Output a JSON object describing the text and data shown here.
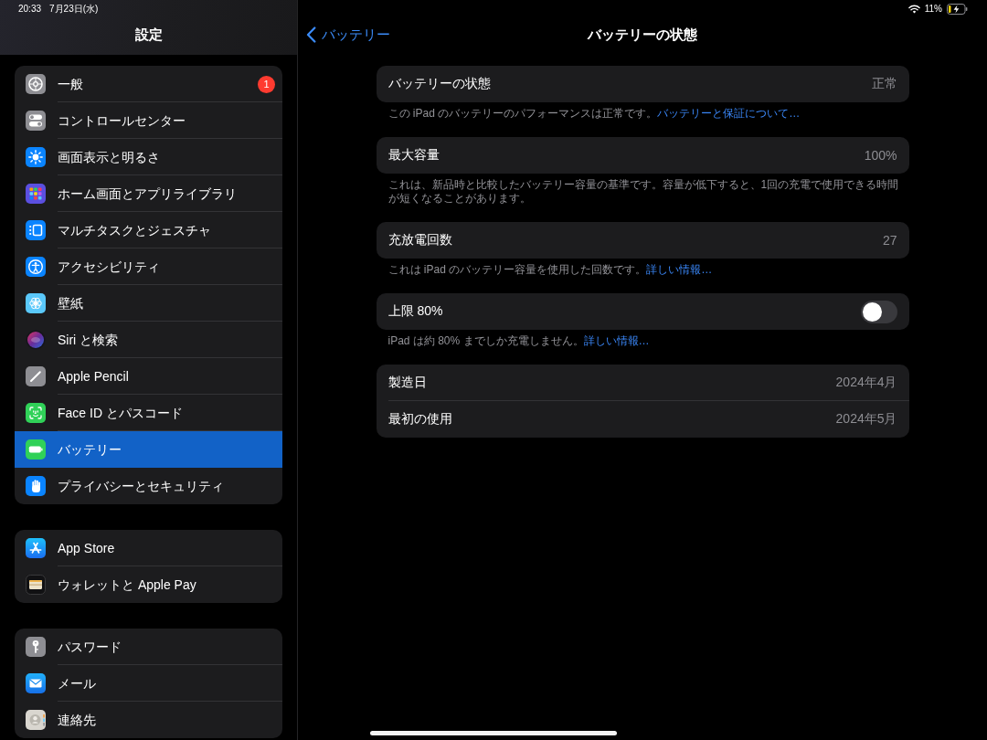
{
  "status_bar": {
    "time": "20:33",
    "date": "7月23日(水)",
    "battery": "11%"
  },
  "sidebar": {
    "title": "設定",
    "groups": [
      {
        "items": [
          {
            "label": "一般",
            "badge": "1",
            "selected": false
          },
          {
            "label": "コントロールセンター",
            "selected": false
          },
          {
            "label": "画面表示と明るさ",
            "selected": false
          },
          {
            "label": "ホーム画面とアプリライブラリ",
            "selected": false
          },
          {
            "label": "マルチタスクとジェスチャ",
            "selected": false
          },
          {
            "label": "アクセシビリティ",
            "selected": false
          },
          {
            "label": "壁紙",
            "selected": false
          },
          {
            "label": "Siri と検索",
            "selected": false
          },
          {
            "label": "Apple Pencil",
            "selected": false
          },
          {
            "label": "Face ID とパスコード",
            "selected": false
          },
          {
            "label": "バッテリー",
            "selected": true
          },
          {
            "label": "プライバシーとセキュリティ",
            "selected": false
          }
        ]
      },
      {
        "items": [
          {
            "label": "App Store",
            "selected": false
          },
          {
            "label": "ウォレットと Apple Pay",
            "selected": false
          }
        ]
      },
      {
        "items": [
          {
            "label": "パスワード",
            "selected": false
          },
          {
            "label": "メール",
            "selected": false
          },
          {
            "label": "連絡先",
            "selected": false
          }
        ]
      }
    ]
  },
  "nav_bar": {
    "back": "バッテリー",
    "title": "バッテリーの状態"
  },
  "sections": [
    {
      "rows": [
        {
          "kind": "value",
          "label": "バッテリーの状態",
          "value": "正常"
        }
      ],
      "footer": {
        "text": "この iPad のバッテリーのパフォーマンスは正常です。",
        "link": "バッテリーと保証について…"
      }
    },
    {
      "rows": [
        {
          "kind": "value",
          "label": "最大容量",
          "value": "100%"
        }
      ],
      "footer": {
        "text": "これは、新品時と比較したバッテリー容量の基準です。容量が低下すると、1回の充電で使用できる時間が短くなることがあります。"
      }
    },
    {
      "rows": [
        {
          "kind": "value",
          "label": "充放電回数",
          "value": "27"
        }
      ],
      "footer": {
        "text": "これは iPad のバッテリー容量を使用した回数です。",
        "link": "詳しい情報…"
      }
    },
    {
      "rows": [
        {
          "kind": "toggle",
          "label": "上限 80%",
          "on": false
        }
      ],
      "footer": {
        "text": "iPad は約 80% までしか充電しません。",
        "link": "詳しい情報…"
      }
    },
    {
      "rows": [
        {
          "kind": "value",
          "label": "製造日",
          "value": "2024年4月"
        },
        {
          "kind": "value",
          "label": "最初の使用",
          "value": "2024年5月"
        }
      ]
    }
  ]
}
